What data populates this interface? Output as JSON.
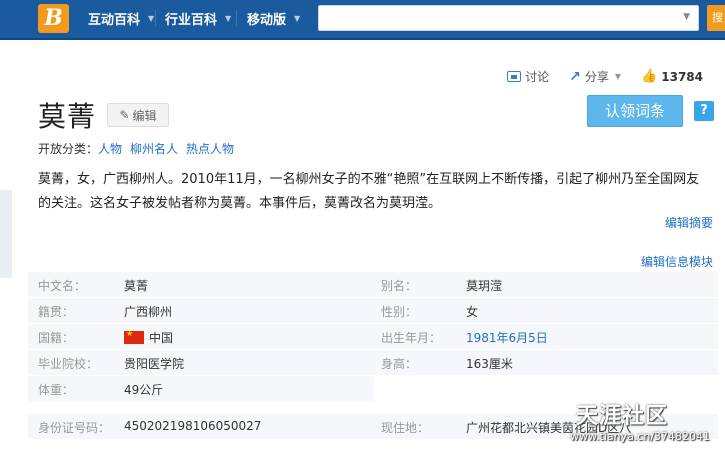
{
  "topbar": {
    "logo_letter": "B",
    "nav": [
      {
        "label": "互动百科"
      },
      {
        "label": "行业百科"
      },
      {
        "label": "移动版"
      }
    ],
    "search_placeholder": "",
    "search_button": "搜"
  },
  "actions": {
    "discuss": "讨论",
    "share": "分享",
    "like_count": "13784"
  },
  "entry": {
    "title": "莫菁",
    "edit_label": "编辑",
    "claim_label": "认领词条",
    "help_label": "?"
  },
  "categories": {
    "prefix": "开放分类：",
    "items": [
      "人物",
      "柳州名人",
      "热点人物"
    ]
  },
  "summary": {
    "text": "莫菁，女，广西柳州人。2010年11月，一名柳州女子的不雅“艳照”在互联网上不断传播，引起了柳州乃至全国网友的关注。这名女子被发帖者称为莫菁。本事件后，莫菁改名为莫玥滢。",
    "edit_summary": "编辑摘要",
    "edit_info": "编辑信息模块"
  },
  "info": {
    "rows": [
      {
        "l1": "中文名：",
        "v1": "莫菁",
        "l2": "别名：",
        "v2": "莫玥滢"
      },
      {
        "l1": "籍贯：",
        "v1": "广西柳州",
        "l2": "性别：",
        "v2": "女"
      },
      {
        "l1": "国籍：",
        "v1": "中国",
        "l2": "出生年月：",
        "v2": "1981年6月5日"
      },
      {
        "l1": "毕业院校：",
        "v1": "贵阳医学院",
        "l2": "身高：",
        "v2": "163厘米"
      },
      {
        "l1": "体重：",
        "v1": "49公斤",
        "l2": "",
        "v2": ""
      }
    ],
    "id_row": {
      "l1": "身份证号码：",
      "v1": "450202198106050027",
      "l2": "现住地：",
      "v2": "广州花都北兴镇美茵花园D区八"
    }
  },
  "watermark": {
    "brand": "天涯社区",
    "url": "www.tianya.cn/37482041"
  }
}
